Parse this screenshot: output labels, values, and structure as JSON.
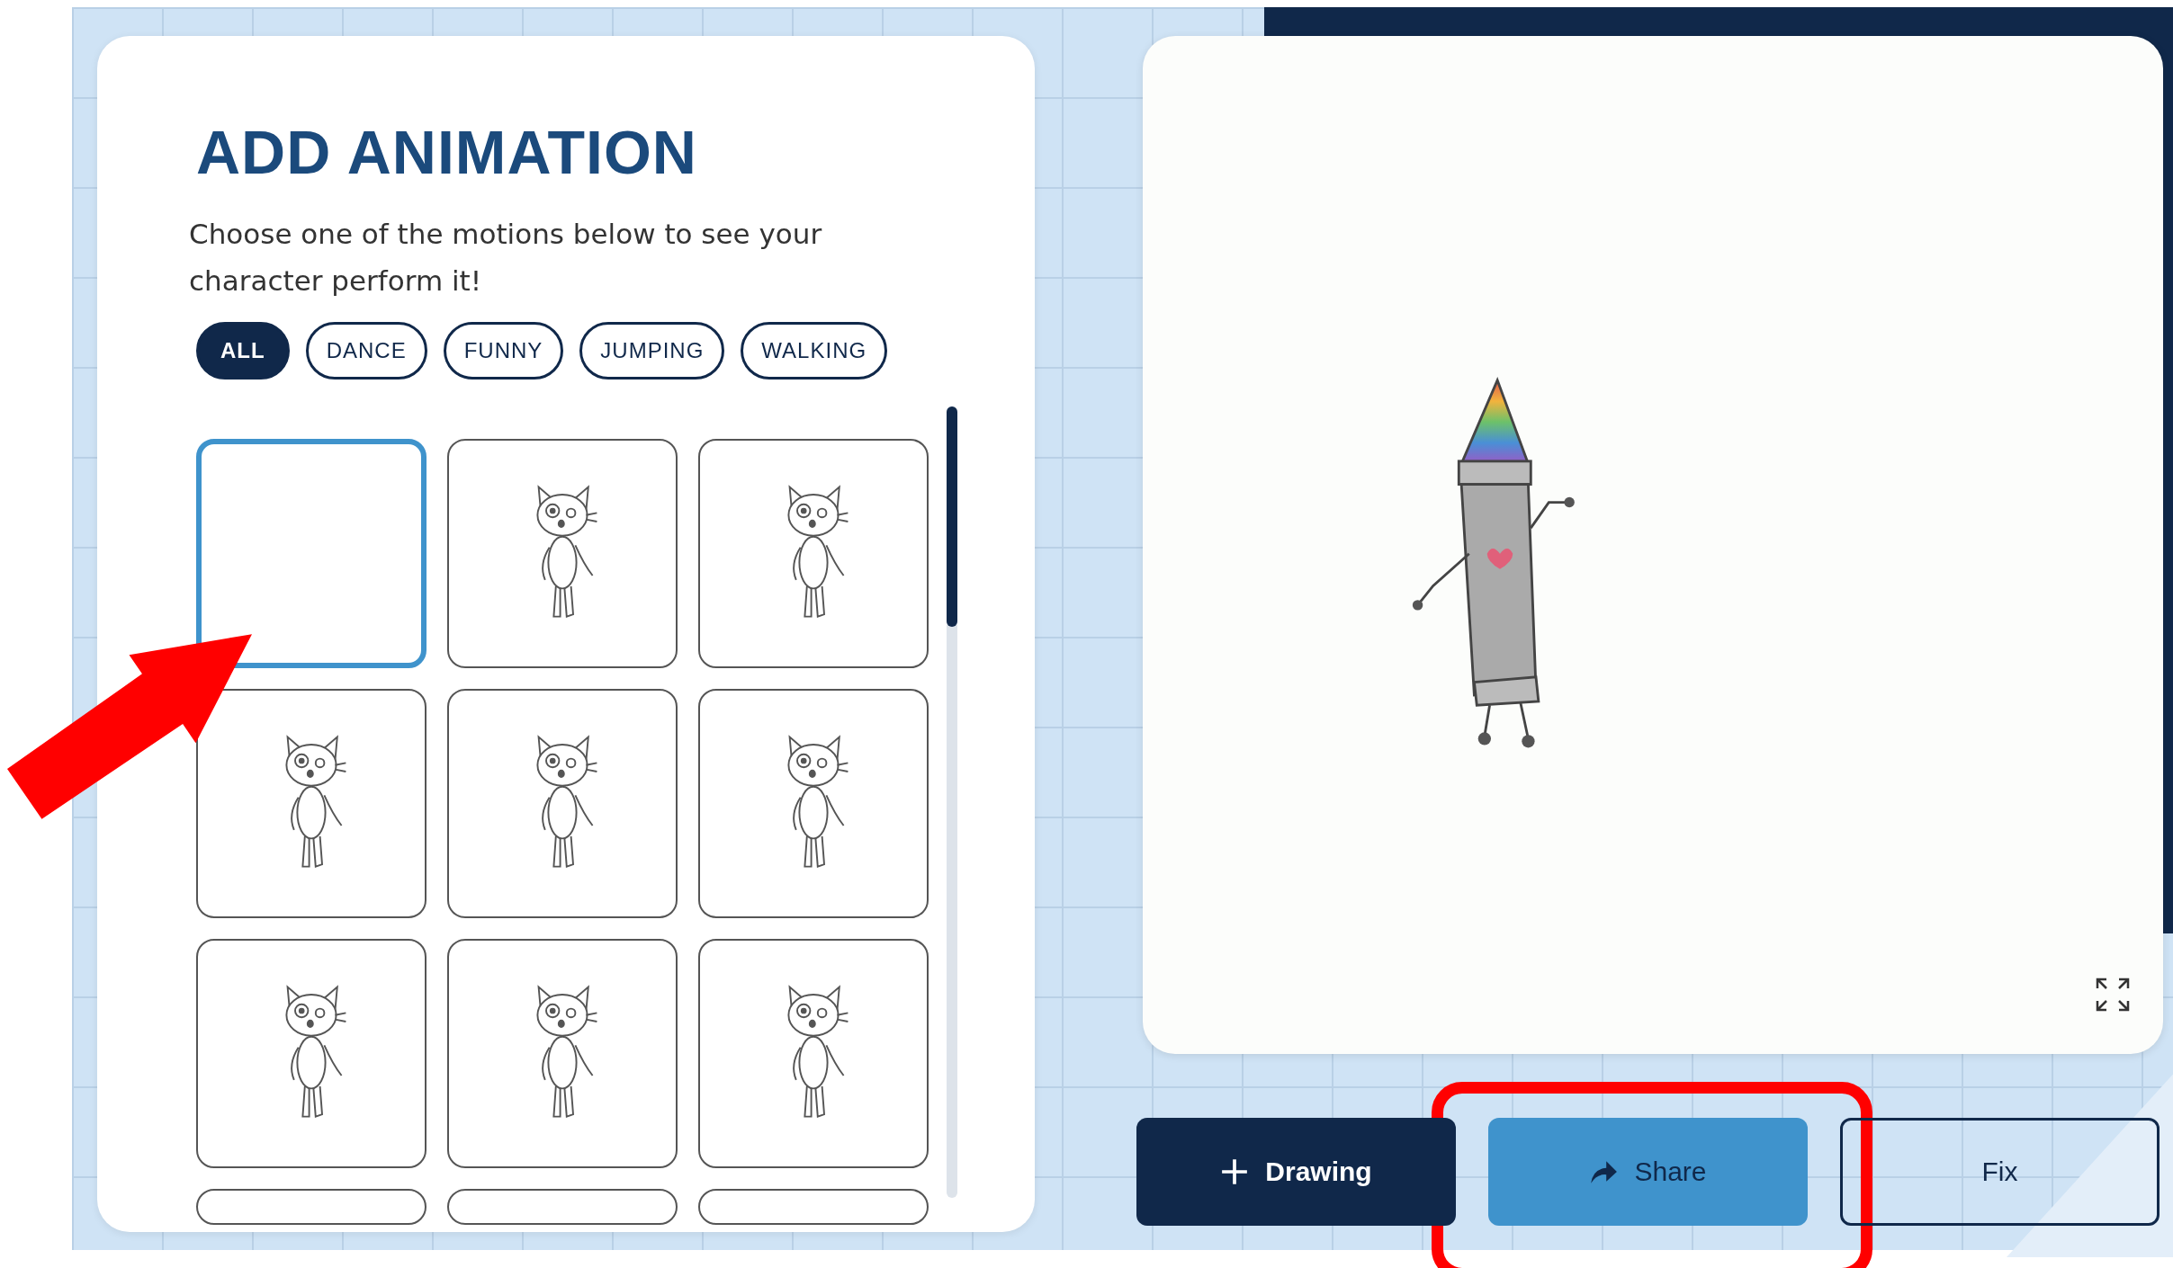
{
  "panel": {
    "title": "ADD ANIMATION",
    "description": "Choose one of the motions below to see your character perform it!"
  },
  "filters": [
    {
      "label": "ALL",
      "selected": true
    },
    {
      "label": "DANCE",
      "selected": false
    },
    {
      "label": "FUNNY",
      "selected": false
    },
    {
      "label": "JUMPING",
      "selected": false
    },
    {
      "label": "WALKING",
      "selected": false
    }
  ],
  "motions": [
    {
      "kind": "blank",
      "selected": true
    },
    {
      "kind": "cat",
      "selected": false
    },
    {
      "kind": "cat",
      "selected": false
    },
    {
      "kind": "cat",
      "selected": false
    },
    {
      "kind": "cat",
      "selected": false
    },
    {
      "kind": "cat",
      "selected": false
    },
    {
      "kind": "cat",
      "selected": false
    },
    {
      "kind": "cat",
      "selected": false
    },
    {
      "kind": "cat",
      "selected": false
    }
  ],
  "actions": [
    {
      "kind": "add",
      "label": "Drawing"
    },
    {
      "kind": "share",
      "label": "Share"
    },
    {
      "kind": "outline",
      "label": "Fix"
    }
  ]
}
